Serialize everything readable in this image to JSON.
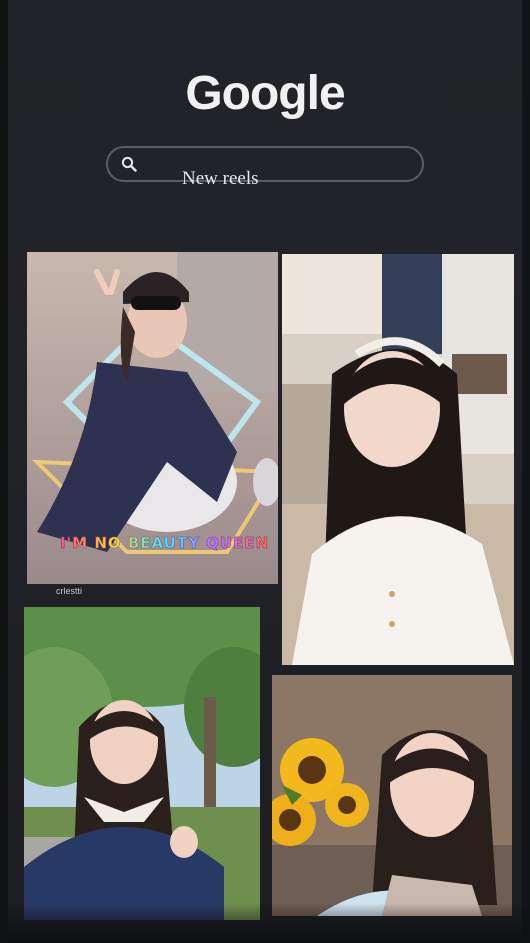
{
  "header": {
    "logo_text": "Google",
    "search": {
      "text": "New reels",
      "icon": "search-icon"
    }
  },
  "photos": [
    {
      "id": "photo-1",
      "overlay_text": "I'M NO BEAUTY QUEEN",
      "caption": "crlestti"
    },
    {
      "id": "photo-2"
    },
    {
      "id": "photo-3"
    },
    {
      "id": "photo-4"
    }
  ],
  "colors": {
    "background": "#1b1c20",
    "logo": "#f1f1f1",
    "search_border": "#5b5c61"
  }
}
